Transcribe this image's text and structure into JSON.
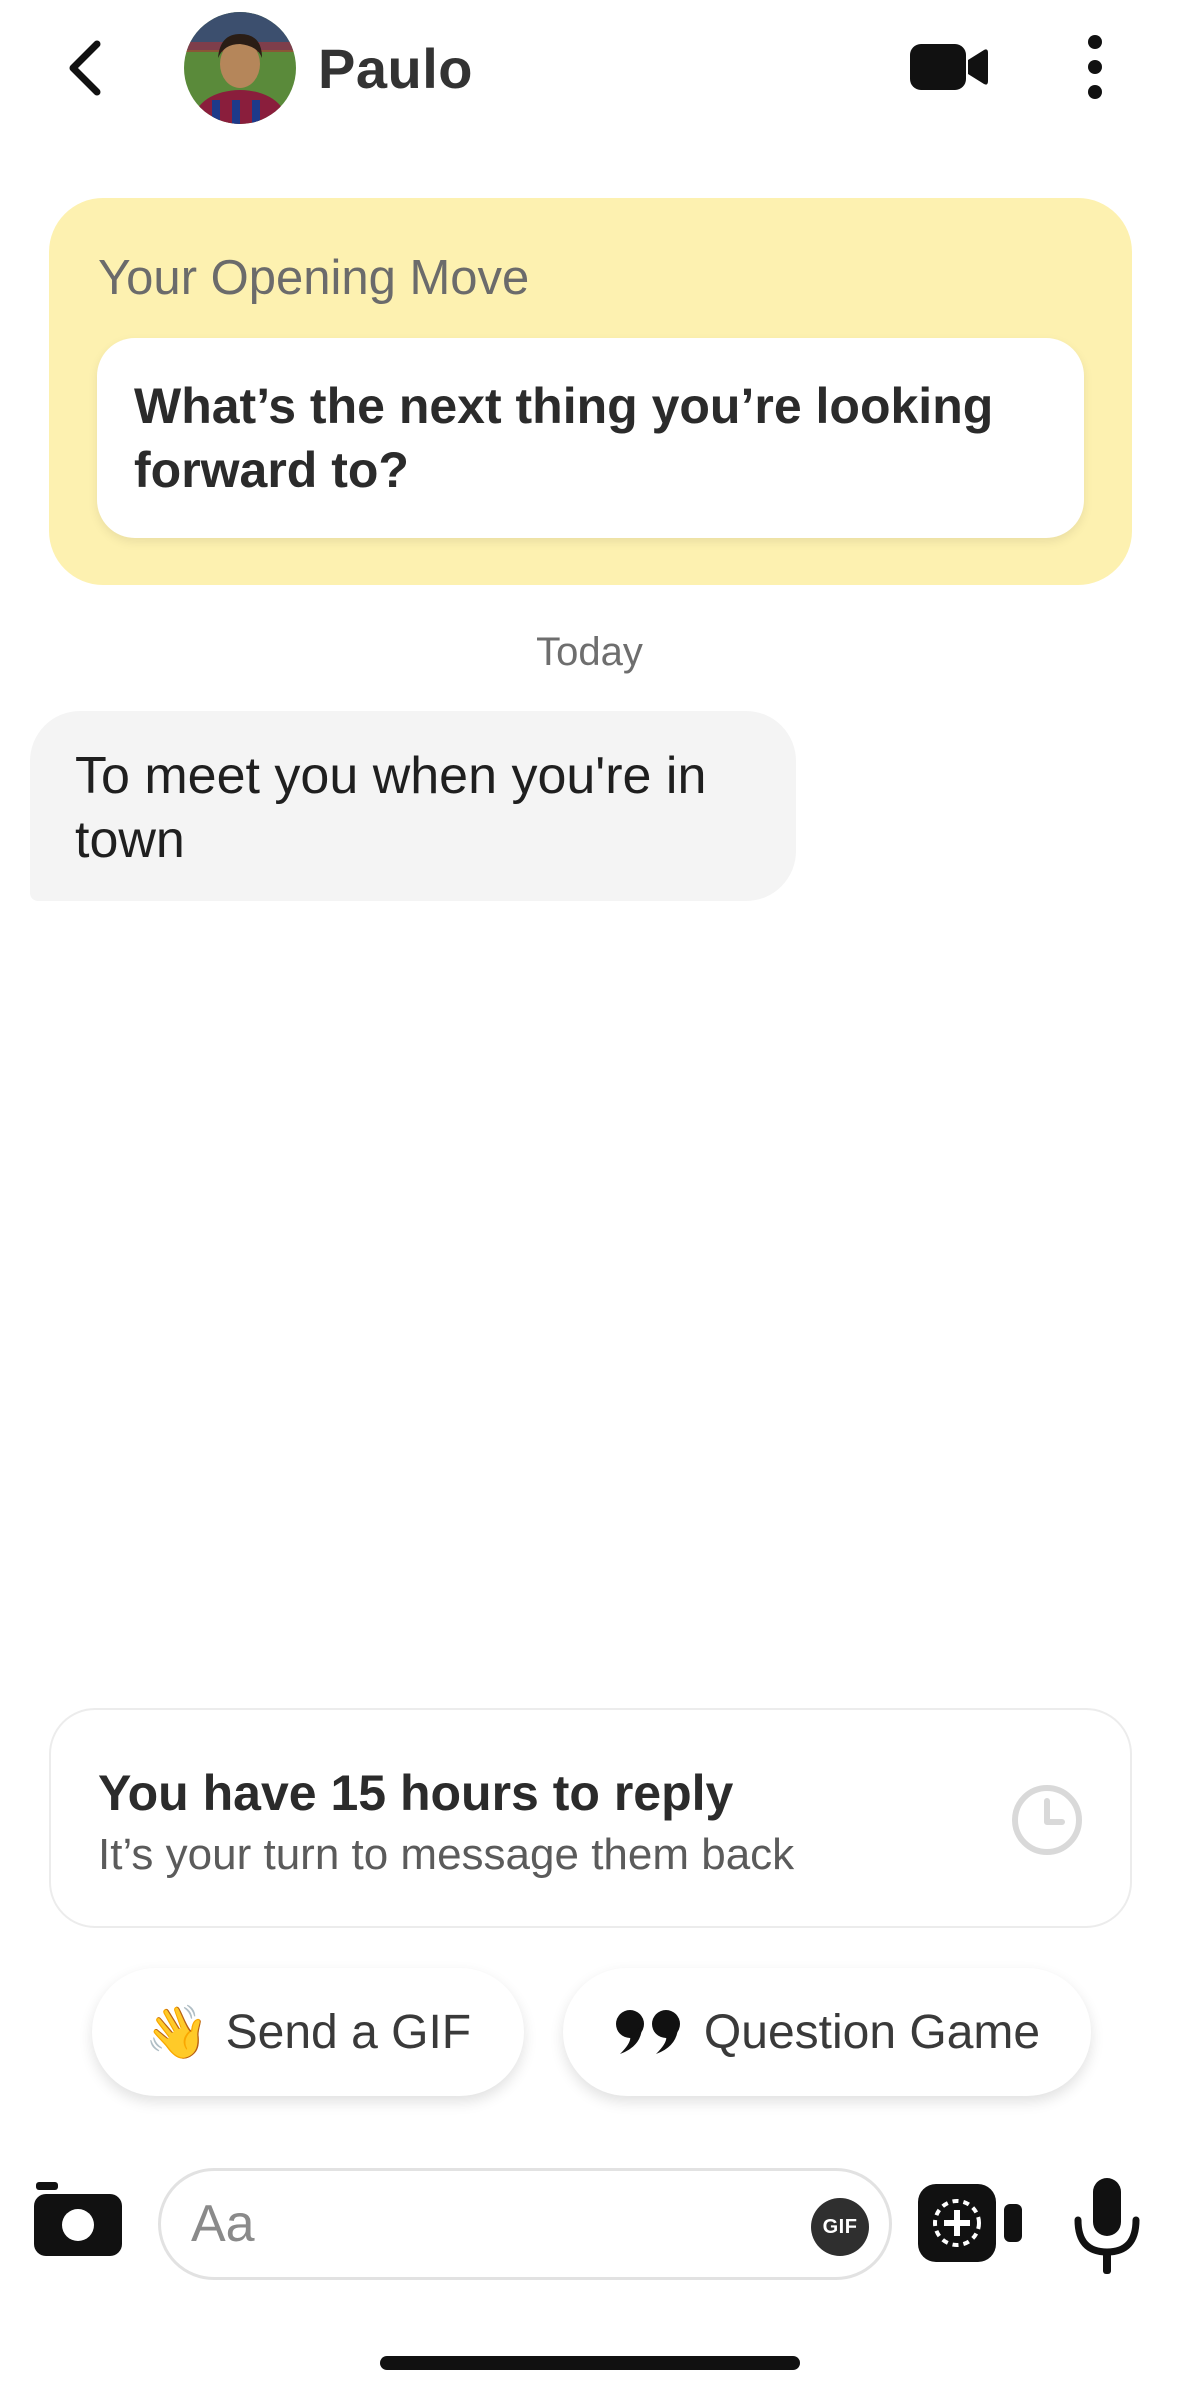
{
  "header": {
    "contact_name": "Paulo",
    "back_icon": "chevron-left-icon",
    "video_icon": "video-camera-icon",
    "more_icon": "more-vertical-icon"
  },
  "opening_move": {
    "label": "Your Opening Move",
    "question": "What’s the next thing you’re looking forward to?",
    "background_color": "#fdf1b0"
  },
  "conversation": {
    "day_label": "Today",
    "messages": [
      {
        "from": "Paulo",
        "text": "To meet you when you're in town"
      }
    ]
  },
  "reply_notice": {
    "title": "You have 15 hours to reply",
    "subtitle": "It’s your turn to message them back",
    "icon": "clock-icon"
  },
  "suggestions": [
    {
      "emoji": "👋",
      "label": "Send a GIF"
    },
    {
      "icon": "quote-icon",
      "label": "Question Game"
    }
  ],
  "composer": {
    "placeholder": "Aa",
    "value": "",
    "gif_label": "GIF",
    "camera_icon": "camera-icon",
    "video_note_icon": "video-note-icon",
    "mic_icon": "microphone-icon"
  }
}
